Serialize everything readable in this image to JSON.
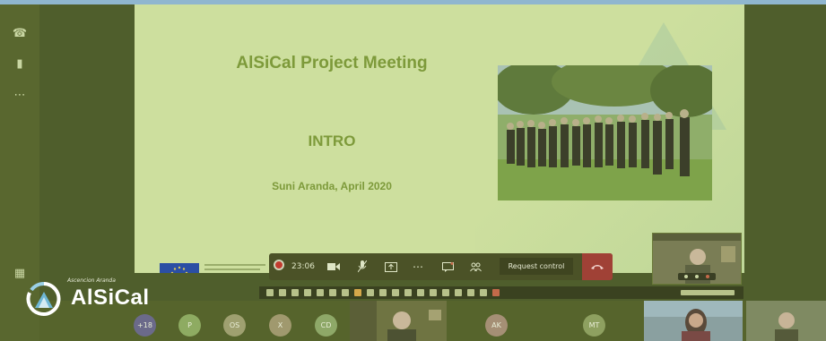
{
  "slide": {
    "title": "AlSiCal Project Meeting",
    "intro": "INTRO",
    "author": "Suni Aranda, April  2020"
  },
  "meeting_controls": {
    "timer": "23:06",
    "request_control_label": "Request control"
  },
  "logo": {
    "name": "AlSiCal",
    "small_text": "Ascencion Aranda"
  },
  "participants": [
    {
      "initials": "+18",
      "color": "#6b6a8a"
    },
    {
      "initials": "P",
      "color": "#8eab62"
    },
    {
      "initials": "OS",
      "color": "#9fa070"
    },
    {
      "initials": "X",
      "color": "#a0996e"
    },
    {
      "initials": "CD",
      "color": "#8ea868"
    },
    {
      "initials": "AK",
      "color": "#a58f75"
    },
    {
      "initials": "MT",
      "color": "#8ea060"
    }
  ],
  "icons": [
    "phone-icon",
    "document-icon",
    "more-icon",
    "camera-icon",
    "mic-icon",
    "share-icon",
    "chat-icon",
    "participants-icon",
    "hangup-icon"
  ]
}
